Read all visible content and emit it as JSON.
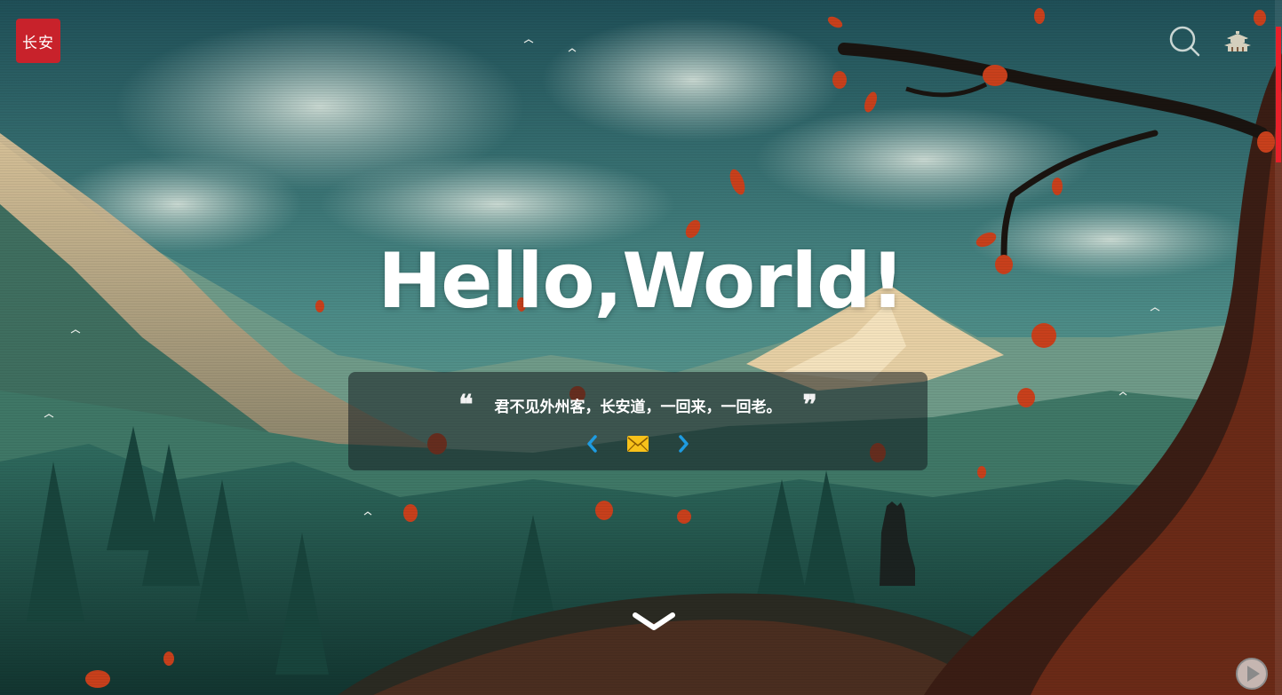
{
  "header": {
    "logo_text": "长安",
    "search_icon": "search-icon",
    "home_icon": "pagoda-home-icon"
  },
  "hero": {
    "title": "Hello,World!"
  },
  "quote": {
    "open_mark": "❝",
    "text": "君不见外州客，长安道，一回来，一回老。",
    "close_mark": "❞",
    "prev_icon": "chevron-left-icon",
    "mail_icon": "mail-icon",
    "next_icon": "chevron-right-icon"
  },
  "scroll_down_icon": "chevron-down-icon",
  "music_icon": "play-icon",
  "colors": {
    "brand_red": "#c8222b",
    "scroll_thumb": "#e8202a",
    "chevron_blue": "#1e9be0",
    "mail_yellow": "#f7c11a"
  }
}
